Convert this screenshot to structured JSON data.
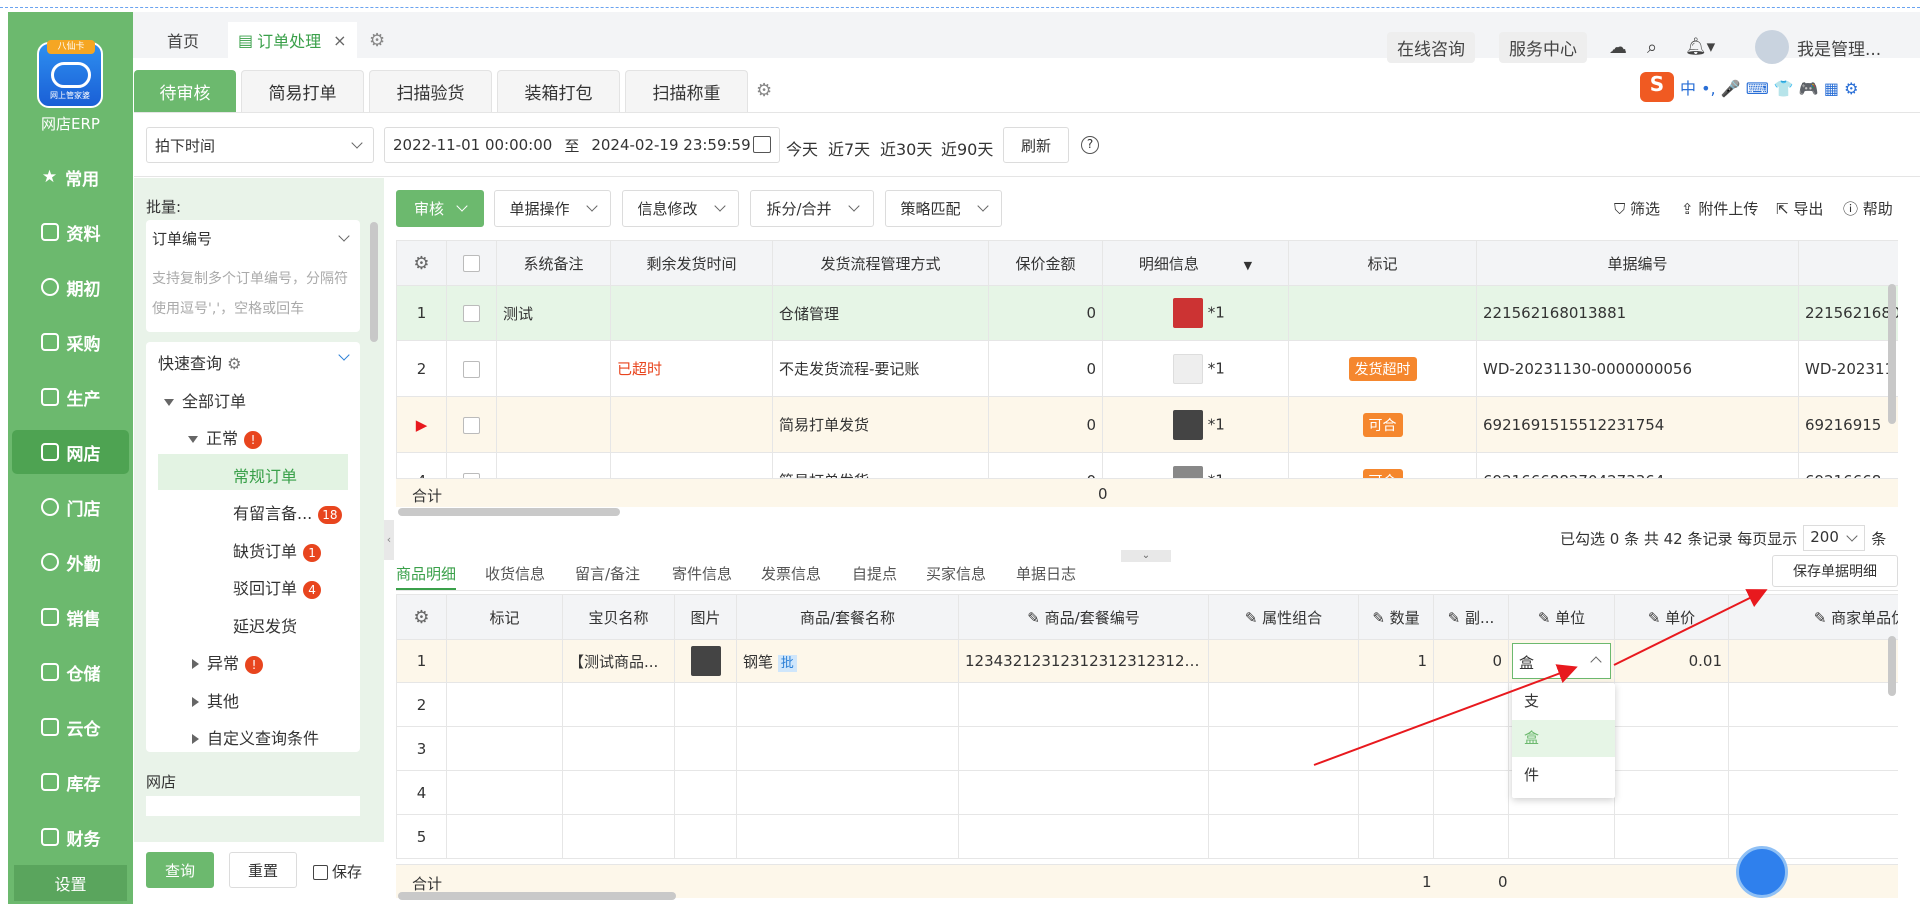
{
  "app": {
    "name": "网店ERP",
    "logo_tag": "八仙卡",
    "logo_sub": "网上管家婆"
  },
  "sidebar": {
    "items": [
      {
        "label": "常用",
        "icon": "star-icon"
      },
      {
        "label": "资料",
        "icon": "document-icon"
      },
      {
        "label": "期初",
        "icon": "circle-icon"
      },
      {
        "label": "采购",
        "icon": "purchase-icon"
      },
      {
        "label": "生产",
        "icon": "production-icon"
      },
      {
        "label": "网店",
        "icon": "store-icon",
        "active": true
      },
      {
        "label": "门店",
        "icon": "pie-icon"
      },
      {
        "label": "外勤",
        "icon": "fieldwork-icon"
      },
      {
        "label": "销售",
        "icon": "sales-icon"
      },
      {
        "label": "仓储",
        "icon": "warehouse-icon"
      },
      {
        "label": "云仓",
        "icon": "cloud-warehouse-icon"
      },
      {
        "label": "库存",
        "icon": "home-icon"
      },
      {
        "label": "财务",
        "icon": "finance-icon"
      }
    ],
    "settings_label": "设置"
  },
  "top_tabs": {
    "home": "首页",
    "active": "订单处理",
    "close": "×"
  },
  "top_right": {
    "consult": "在线咨询",
    "service": "服务中心",
    "user": "我是管理..."
  },
  "module_tabs": [
    "待审核",
    "简易打单",
    "扫描验货",
    "装箱打包",
    "扫描称重"
  ],
  "ime_bar": {
    "logo": "S",
    "text": "中 •, 🎤 ⌨ 👕 🎮 ▦ ⚙"
  },
  "filter": {
    "time_type": "拍下时间",
    "start": "2022-11-01 00:00:00",
    "to": "至",
    "end": "2024-02-19 23:59:59",
    "quick": [
      "今天",
      "近7天",
      "近30天",
      "近90天"
    ],
    "refresh": "刷新"
  },
  "left": {
    "batch_label": "批量:",
    "order_no": "订单编号",
    "placeholder": "支持复制多个订单编号，分隔符使用逗号','，空格或回车",
    "quick_query": "快速查询",
    "tree": {
      "all": "全部订单",
      "normal": "正常",
      "regular": "常规订单",
      "remark": "有留言备...",
      "remark_count": "18",
      "shortage": "缺货订单",
      "shortage_count": "1",
      "rejected": "驳回订单",
      "rejected_count": "4",
      "delayed": "延迟发货",
      "abnormal": "异常",
      "other": "其他",
      "custom": "自定义查询条件"
    },
    "shop_label": "网店",
    "query": "查询",
    "reset": "重置",
    "save": "保存"
  },
  "toolbar": {
    "audit": "审核",
    "ops": [
      "单据操作",
      "信息修改",
      "拆分/合并",
      "策略匹配"
    ],
    "filter": "筛选",
    "upload": "附件上传",
    "export": "导出",
    "help": "帮助"
  },
  "orders": {
    "headers": [
      "系统备注",
      "剩余发货时间",
      "发货流程管理方式",
      "保价金额",
      "明细信息",
      "标记",
      "单据编号"
    ],
    "rows": [
      {
        "idx": "1",
        "remark": "测试",
        "remain": "",
        "flow": "仓储管理",
        "amount": "0",
        "detail": "*1",
        "tag": "",
        "no": "221562168013881",
        "no2": "2215621680"
      },
      {
        "idx": "2",
        "remark": "",
        "remain": "已超时",
        "flow": "不走发货流程-要记账",
        "amount": "0",
        "detail": "*1",
        "tag": "发货超时",
        "no": "WD-20231130-0000000056",
        "no2": "WD-202311"
      },
      {
        "idx": "▶",
        "remark": "",
        "remain": "",
        "flow": "简易打单发货",
        "amount": "0",
        "detail": "*1",
        "tag": "可合",
        "no": "6921691515512231754",
        "no2": "69216915"
      },
      {
        "idx": "4",
        "remark": "",
        "remain": "",
        "flow": "简易打单发货",
        "amount": "0",
        "detail": "*1",
        "tag": "可合",
        "no": "6921666882704273364",
        "no2": "69216668"
      }
    ],
    "total_label": "合计",
    "total_amount": "0",
    "pager": {
      "info": "已勾选 0 条 共 42 条记录 每页显示",
      "size": "200",
      "unit": "条"
    }
  },
  "bottom_tabs": [
    "商品明细",
    "收货信息",
    "留言/备注",
    "寄件信息",
    "发票信息",
    "我的自提点",
    "买家信息",
    "单据日志"
  ],
  "bottom_tabs_vis": [
    "商品明细",
    "收货信息",
    "留言/备注",
    "寄件信息",
    "发票信息",
    "自提点",
    "买家信息",
    "单据日志"
  ],
  "save_detail": "保存单据明细",
  "items": {
    "headers": [
      "标记",
      "宝贝名称",
      "图片",
      "商品/套餐名称",
      "商品/套餐编号",
      "属性组合",
      "数量",
      "副...",
      "单位",
      "单价",
      "商家单品优惠金额"
    ],
    "row": {
      "idx": "1",
      "name": "【测试商品...",
      "goods": "钢笔",
      "batch": "批",
      "code": "123432123123123123123123...",
      "qty": "1",
      "sub": "0",
      "unit": "盒",
      "price": "0.01"
    },
    "empty_rows": [
      "2",
      "3",
      "4",
      "5"
    ],
    "total_label": "合计",
    "total_qty": "1",
    "total_sub": "0"
  },
  "unit_dropdown": {
    "options": [
      "支",
      "盒",
      "件"
    ],
    "selected": "盒"
  }
}
